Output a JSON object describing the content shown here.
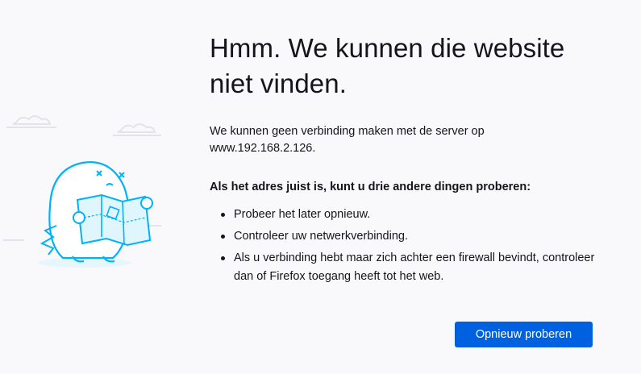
{
  "error": {
    "title": "Hmm. We kunnen die website niet vinden.",
    "description": "We kunnen geen verbinding maken met de server op www.192.168.2.126.",
    "subheading": "Als het adres juist is, kunt u drie andere dingen proberen:",
    "suggestions": [
      "Probeer het later opnieuw.",
      "Controleer uw netwerkverbinding.",
      "Als u verbinding hebt maar zich achter een firewall bevindt, controleer dan of Firefox toegang heeft tot het web."
    ],
    "retry_label": "Opnieuw proberen"
  },
  "colors": {
    "background": "#f9f9fb",
    "accent": "#0061e0",
    "illustration": "#00b3f4"
  },
  "icons": {
    "illustration": "confused-monster-with-map-illustration"
  }
}
